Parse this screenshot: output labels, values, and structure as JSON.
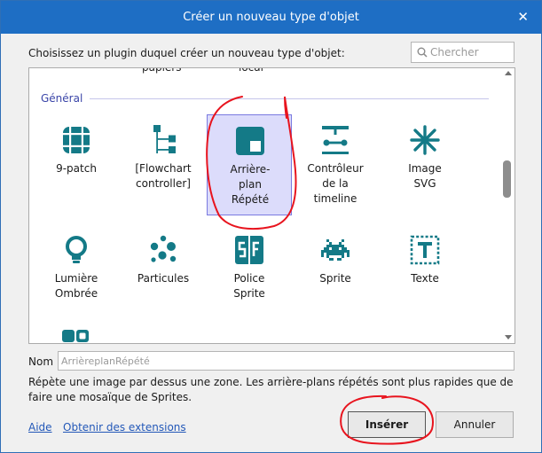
{
  "window": {
    "title": "Créer un nouveau type d'objet",
    "close_glyph": "✕"
  },
  "prompt": "Choisissez un plugin duquel créer un nouveau type d'objet:",
  "search": {
    "placeholder": "Chercher",
    "icon": "search-icon"
  },
  "list": {
    "previous_row_partial": [
      "papiers",
      "local"
    ],
    "group_label": "Général",
    "items": [
      {
        "label": "9-patch",
        "icon": "nine-patch-icon",
        "selected": false
      },
      {
        "label": "[Flowchart controller]",
        "icon": "flowchart-icon",
        "selected": false
      },
      {
        "label": "Arrière-plan Répété",
        "icon": "tiled-background-icon",
        "selected": true
      },
      {
        "label": "Contrôleur de la timeline",
        "icon": "timeline-controller-icon",
        "selected": false
      },
      {
        "label": "Image SVG",
        "icon": "svg-image-icon",
        "selected": false
      },
      {
        "label": "Lumière Ombrée",
        "icon": "light-bulb-icon",
        "selected": false
      },
      {
        "label": "Particules",
        "icon": "particles-icon",
        "selected": false
      },
      {
        "label": "Police Sprite",
        "icon": "sprite-font-icon",
        "selected": false
      },
      {
        "label": "Sprite",
        "icon": "space-invader-icon",
        "selected": false
      },
      {
        "label": "Texte",
        "icon": "text-icon",
        "selected": false
      }
    ],
    "next_row_partial_icon": "toggle-icon"
  },
  "name_field": {
    "label": "Nom",
    "placeholder": "ArrièreplanRépété"
  },
  "description": "Répète une image par dessus une zone. Les arrière-plans répétés sont plus rapides que de faire une mosaïque de Sprites.",
  "links": {
    "help": "Aide",
    "extensions": "Obtenir des extensions"
  },
  "buttons": {
    "insert": "Insérer",
    "cancel": "Annuler"
  },
  "colors": {
    "titlebar": "#1e6ec4",
    "icon_teal": "#147a87",
    "selection": "#dcdcfb",
    "annotation_red": "#e8141e",
    "group_label": "#3a45a8"
  }
}
